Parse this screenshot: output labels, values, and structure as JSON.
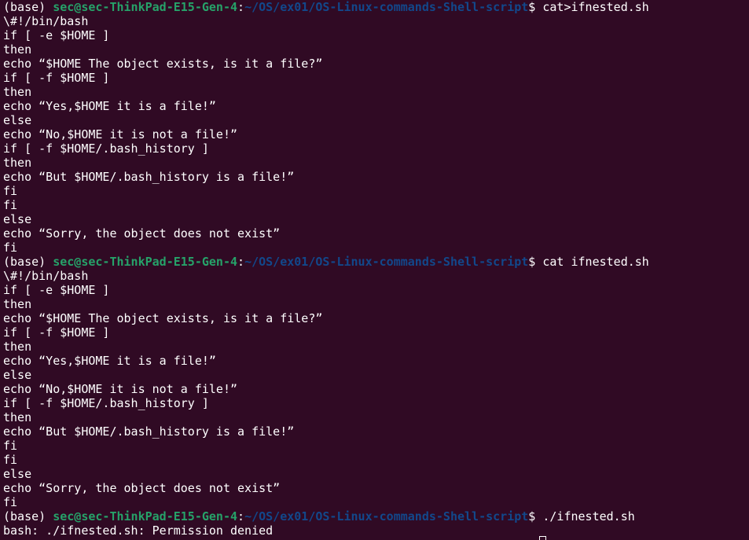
{
  "colors": {
    "background": "#300a24",
    "text": "#ffffff",
    "prompt_user_host": "#26a269",
    "prompt_path": "#12488b"
  },
  "lines": [
    {
      "kind": "prompt",
      "env": "(base) ",
      "userhost": "sec@sec-ThinkPad-E15-Gen-4",
      "sep": ":",
      "path": "~/OS/ex01/OS-Linux-commands-Shell-script",
      "symbol": "$ ",
      "command": "cat>ifnested.sh"
    },
    {
      "kind": "output",
      "text": "\\#!/bin/bash"
    },
    {
      "kind": "output",
      "text": "if [ -e $HOME ]"
    },
    {
      "kind": "output",
      "text": "then"
    },
    {
      "kind": "output",
      "text": "echo “$HOME The object exists, is it a file?”"
    },
    {
      "kind": "output",
      "text": "if [ -f $HOME ]"
    },
    {
      "kind": "output",
      "text": "then"
    },
    {
      "kind": "output",
      "text": "echo “Yes,$HOME it is a file!”"
    },
    {
      "kind": "output",
      "text": "else"
    },
    {
      "kind": "output",
      "text": "echo “No,$HOME it is not a file!”"
    },
    {
      "kind": "output",
      "text": "if [ -f $HOME/.bash_history ]"
    },
    {
      "kind": "output",
      "text": "then"
    },
    {
      "kind": "output",
      "text": "echo “But $HOME/.bash_history is a file!”"
    },
    {
      "kind": "output",
      "text": "fi"
    },
    {
      "kind": "output",
      "text": "fi"
    },
    {
      "kind": "output",
      "text": "else"
    },
    {
      "kind": "output",
      "text": "echo “Sorry, the object does not exist”"
    },
    {
      "kind": "output",
      "text": "fi"
    },
    {
      "kind": "prompt",
      "env": "(base) ",
      "userhost": "sec@sec-ThinkPad-E15-Gen-4",
      "sep": ":",
      "path": "~/OS/ex01/OS-Linux-commands-Shell-script",
      "symbol": "$ ",
      "command": "cat ifnested.sh"
    },
    {
      "kind": "output",
      "text": "\\#!/bin/bash"
    },
    {
      "kind": "output",
      "text": "if [ -e $HOME ]"
    },
    {
      "kind": "output",
      "text": "then"
    },
    {
      "kind": "output",
      "text": "echo “$HOME The object exists, is it a file?”"
    },
    {
      "kind": "output",
      "text": "if [ -f $HOME ]"
    },
    {
      "kind": "output",
      "text": "then"
    },
    {
      "kind": "output",
      "text": "echo “Yes,$HOME it is a file!”"
    },
    {
      "kind": "output",
      "text": "else"
    },
    {
      "kind": "output",
      "text": "echo “No,$HOME it is not a file!”"
    },
    {
      "kind": "output",
      "text": "if [ -f $HOME/.bash_history ]"
    },
    {
      "kind": "output",
      "text": "then"
    },
    {
      "kind": "output",
      "text": "echo “But $HOME/.bash_history is a file!”"
    },
    {
      "kind": "output",
      "text": "fi"
    },
    {
      "kind": "output",
      "text": "fi"
    },
    {
      "kind": "output",
      "text": "else"
    },
    {
      "kind": "output",
      "text": "echo “Sorry, the object does not exist”"
    },
    {
      "kind": "output",
      "text": "fi"
    },
    {
      "kind": "prompt",
      "env": "(base) ",
      "userhost": "sec@sec-ThinkPad-E15-Gen-4",
      "sep": ":",
      "path": "~/OS/ex01/OS-Linux-commands-Shell-script",
      "symbol": "$ ",
      "command": "./ifnested.sh"
    },
    {
      "kind": "output",
      "text": "bash: ./ifnested.sh: Permission denied"
    }
  ]
}
